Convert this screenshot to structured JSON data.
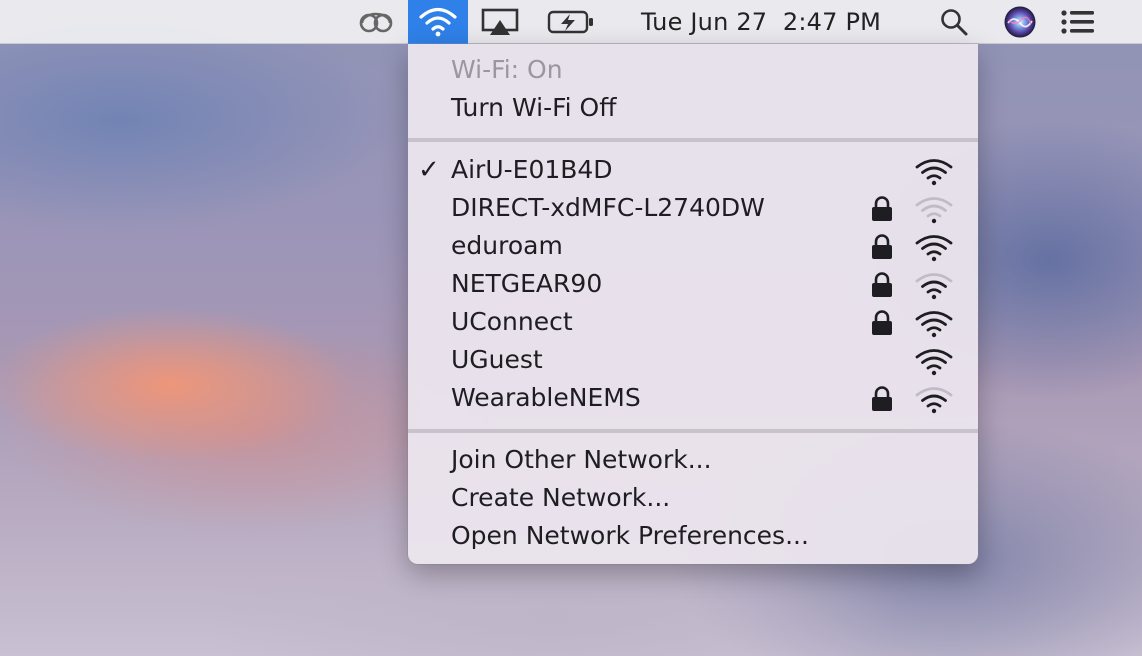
{
  "menubar": {
    "datetime": "Tue Jun 27  2:47 PM",
    "icons": [
      "creative-cloud-icon",
      "wifi-icon",
      "airplay-icon",
      "battery-charging-icon",
      "spotlight-search-icon",
      "siri-icon",
      "notification-center-icon"
    ]
  },
  "wifi_menu": {
    "status": "Wi-Fi: On",
    "toggle_label": "Turn Wi-Fi Off",
    "networks": [
      {
        "name": "AirU-E01B4D",
        "connected": true,
        "locked": false,
        "signal": "strong"
      },
      {
        "name": "DIRECT-xdMFC-L2740DW",
        "connected": false,
        "locked": true,
        "signal": "weak"
      },
      {
        "name": "eduroam",
        "connected": false,
        "locked": true,
        "signal": "strong"
      },
      {
        "name": "NETGEAR90",
        "connected": false,
        "locked": true,
        "signal": "medium"
      },
      {
        "name": "UConnect",
        "connected": false,
        "locked": true,
        "signal": "strong"
      },
      {
        "name": "UGuest",
        "connected": false,
        "locked": false,
        "signal": "strong"
      },
      {
        "name": "WearableNEMS",
        "connected": false,
        "locked": true,
        "signal": "medium"
      }
    ],
    "actions": {
      "join_other": "Join Other Network...",
      "create": "Create Network...",
      "preferences": "Open Network Preferences..."
    },
    "check_glyph": "✓"
  },
  "colors": {
    "menu_highlight": "#2f80e8",
    "text": "#1e1e22",
    "disabled_text": "#9a97a0"
  }
}
